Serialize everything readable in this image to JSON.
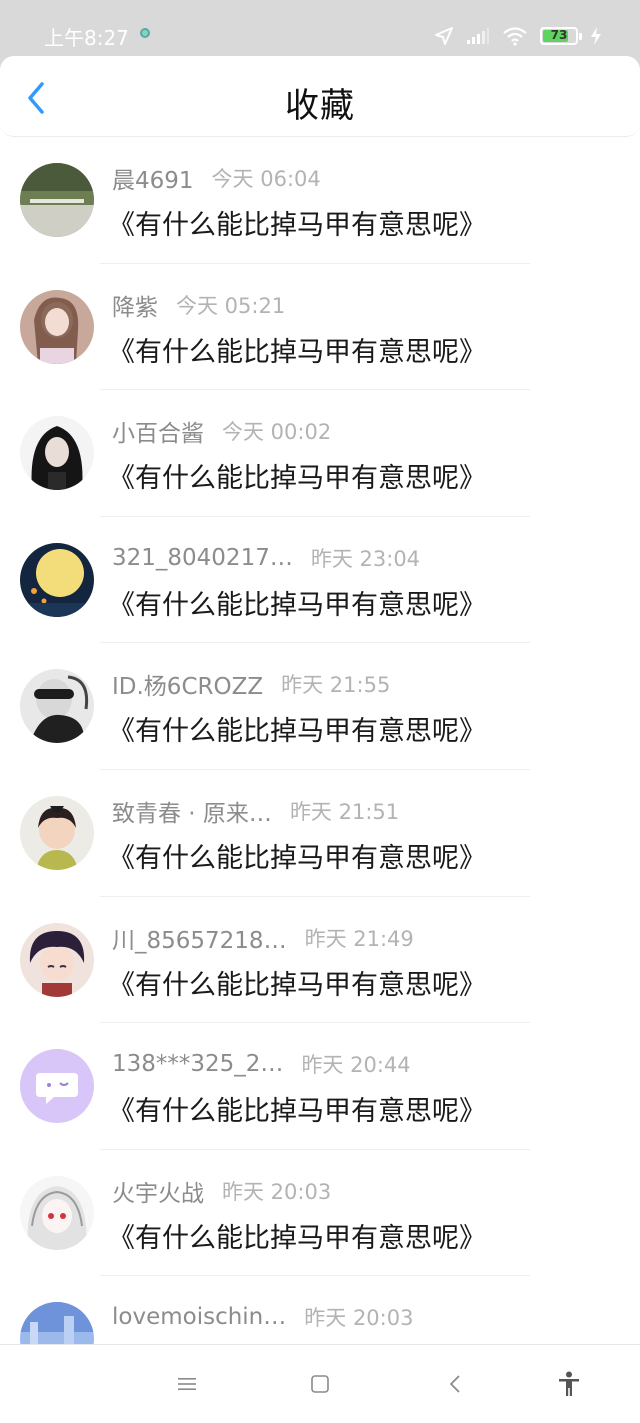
{
  "status_bar": {
    "time": "上午8:27",
    "battery": "73"
  },
  "header": {
    "title": "收藏"
  },
  "items": [
    {
      "username": "晨4691",
      "time": "今天 06:04",
      "title": "《有什么能比掉马甲有意思呢》",
      "avatar": "landscape"
    },
    {
      "username": "降紫",
      "time": "今天 05:21",
      "title": "《有什么能比掉马甲有意思呢》",
      "avatar": "girl-pink"
    },
    {
      "username": "小百合酱",
      "time": "今天 00:02",
      "title": "《有什么能比掉马甲有意思呢》",
      "avatar": "girl-dark"
    },
    {
      "username": "321_8040217…",
      "time": "昨天 23:04",
      "title": "《有什么能比掉马甲有意思呢》",
      "avatar": "moon"
    },
    {
      "username": "ID.杨6CROZZ",
      "time": "昨天 21:55",
      "title": "《有什么能比掉马甲有意思呢》",
      "avatar": "bw-person"
    },
    {
      "username": "致青春 · 原来…",
      "time": "昨天 21:51",
      "title": "《有什么能比掉马甲有意思呢》",
      "avatar": "child"
    },
    {
      "username": "川_85657218…",
      "time": "昨天 21:49",
      "title": "《有什么能比掉马甲有意思呢》",
      "avatar": "anime-boy"
    },
    {
      "username": "138***325_2…",
      "time": "昨天 20:44",
      "title": "《有什么能比掉马甲有意思呢》",
      "avatar": "chat-bubble"
    },
    {
      "username": "火宇火战",
      "time": "昨天 20:03",
      "title": "《有什么能比掉马甲有意思呢》",
      "avatar": "anime-girl-white"
    },
    {
      "username": "lovemoischin…",
      "time": "昨天 20:03",
      "title": "",
      "avatar": "blue-blur"
    }
  ],
  "colors": {
    "accent": "#2f9bff",
    "status_bar_bg": "#d9d9d9",
    "username": "#8c8c8c",
    "timestamp": "#b3b3b3"
  },
  "icons": {
    "back": "chevron-left-icon",
    "menu": "menu-icon",
    "home": "home-square-icon",
    "back_nav": "back-triangle-icon",
    "accessibility": "accessibility-icon"
  }
}
